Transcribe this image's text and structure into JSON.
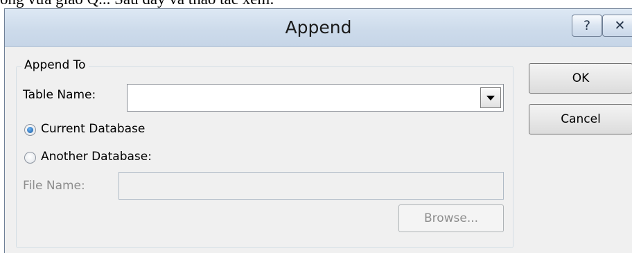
{
  "background_text": "ống vừa giao Q... Sau đây và thao tác xem:",
  "window": {
    "title": "Append",
    "help_glyph": "?",
    "close_glyph": "✕"
  },
  "append_to": {
    "legend": "Append To",
    "table_name_label": "Table Name:",
    "table_name_value": "",
    "current_database_label": "Current Database",
    "current_database_checked": true,
    "another_database_label": "Another Database:",
    "another_database_checked": false,
    "file_name_label": "File Name:",
    "file_name_value": "",
    "browse_label": "Browse..."
  },
  "buttons": {
    "ok_label": "OK",
    "cancel_label": "Cancel"
  }
}
